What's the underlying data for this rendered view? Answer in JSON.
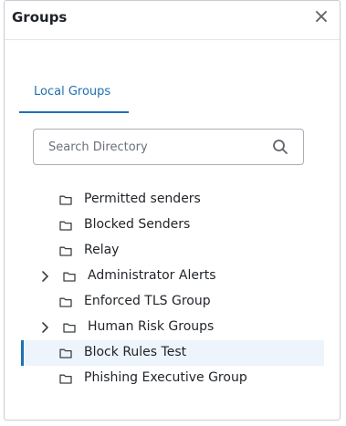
{
  "dialog": {
    "title": "Groups",
    "close_glyph": "×"
  },
  "tabs": [
    {
      "label": "Local Groups",
      "active": true
    }
  ],
  "search": {
    "placeholder": "Search Directory",
    "value": ""
  },
  "tree": [
    {
      "label": "Permitted senders",
      "expandable": false,
      "selected": false
    },
    {
      "label": "Blocked Senders",
      "expandable": false,
      "selected": false
    },
    {
      "label": "Relay",
      "expandable": false,
      "selected": false
    },
    {
      "label": "Administrator Alerts",
      "expandable": true,
      "selected": false
    },
    {
      "label": "Enforced TLS Group",
      "expandable": false,
      "selected": false
    },
    {
      "label": "Human Risk Groups",
      "expandable": true,
      "selected": false
    },
    {
      "label": "Block Rules Test",
      "expandable": false,
      "selected": true
    },
    {
      "label": "Phishing Executive Group",
      "expandable": false,
      "selected": false
    }
  ],
  "colors": {
    "accent": "#1f6fb5",
    "selected_bg": "#eef4fb",
    "text": "#1f2328",
    "border": "#c9cdd2"
  },
  "icons": {
    "close": "close-icon",
    "search": "search-icon",
    "folder": "folder-icon",
    "chevron": "chevron-right-icon"
  }
}
